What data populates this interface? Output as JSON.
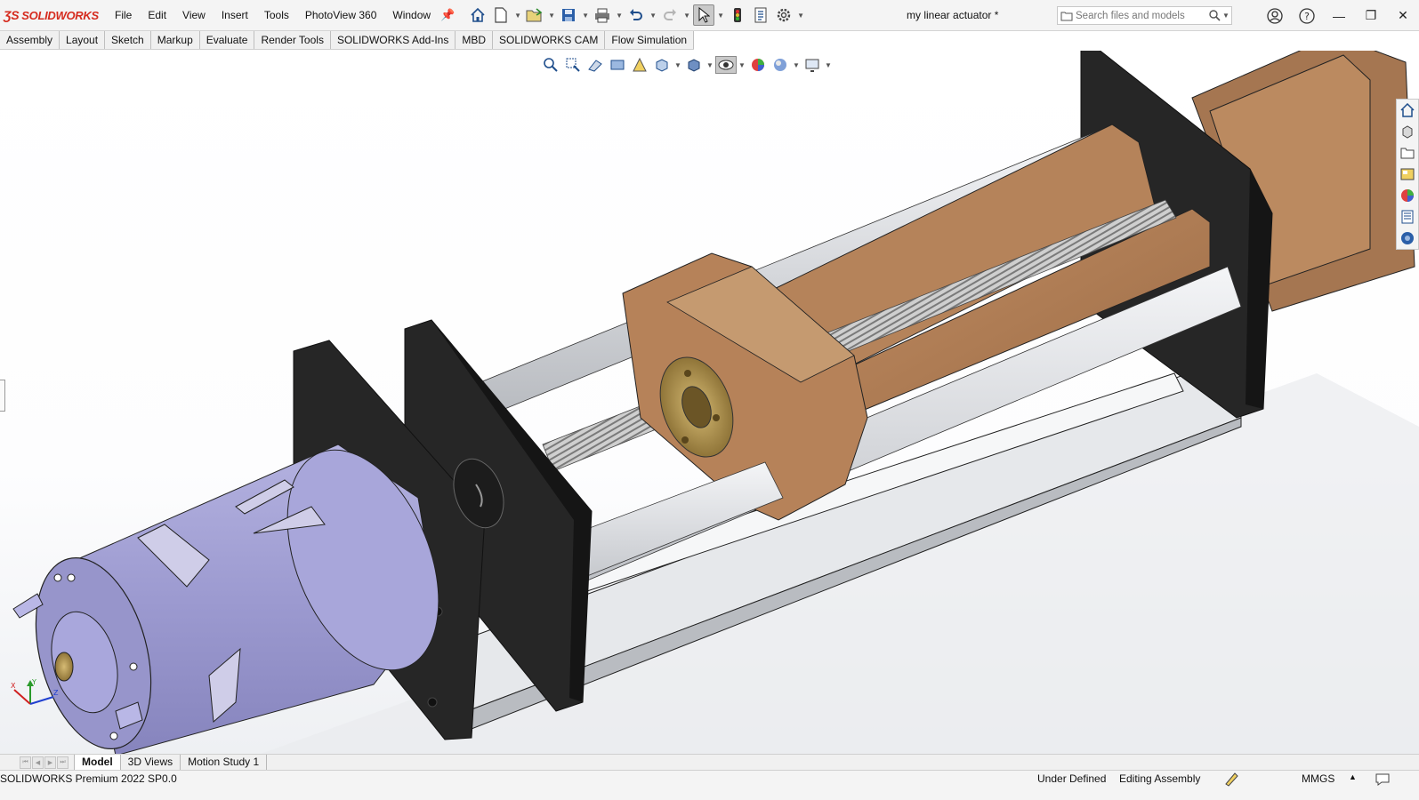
{
  "app": {
    "brand": "SOLIDWORKS",
    "document_title": "my linear actuator *"
  },
  "menu": [
    "File",
    "Edit",
    "View",
    "Insert",
    "Tools",
    "PhotoView 360",
    "Window"
  ],
  "search": {
    "placeholder": "Search files and models"
  },
  "command_tabs": [
    "Assembly",
    "Layout",
    "Sketch",
    "Markup",
    "Evaluate",
    "Render Tools",
    "SOLIDWORKS Add-Ins",
    "MBD",
    "SOLIDWORKS CAM",
    "Flow Simulation"
  ],
  "bottom_tabs": [
    "Model",
    "3D Views",
    "Motion Study 1"
  ],
  "status": {
    "product": "SOLIDWORKS Premium 2022 SP0.0",
    "definition": "Under Defined",
    "mode": "Editing Assembly",
    "units": "MMGS"
  },
  "colors": {
    "brand_red": "#d52b1e",
    "motor": "#9c9ad0",
    "plate": "#2a2a2a",
    "wood": "#b07c54",
    "rod": "#d6d8dc",
    "base": "#e4e6e9",
    "brass": "#b89a56"
  }
}
